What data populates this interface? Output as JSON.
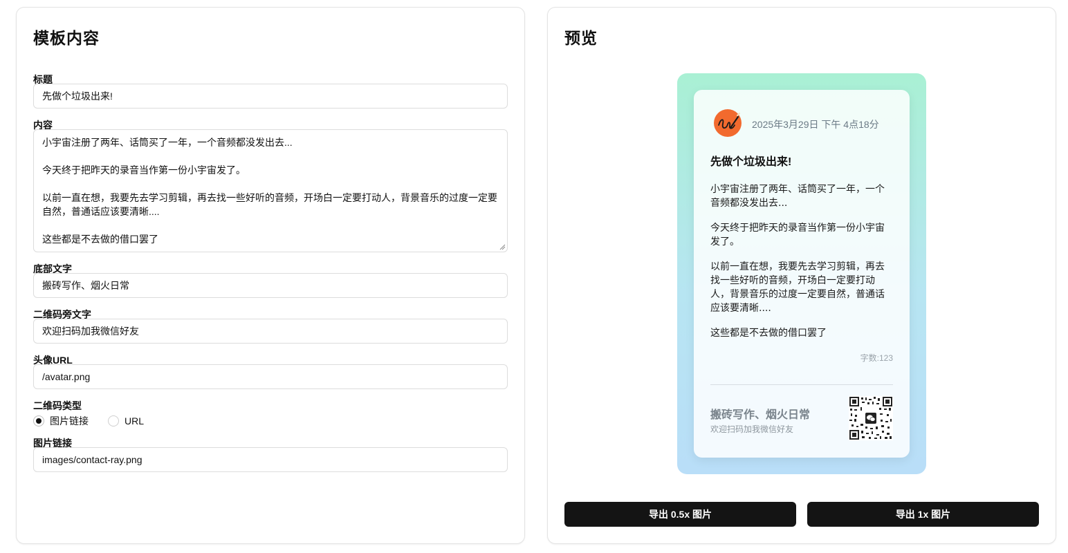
{
  "editor": {
    "title": "模板内容",
    "fields": {
      "title_label": "标题",
      "title_value": "先做个垃圾出来!",
      "content_label": "内容",
      "content_lines": [
        "小宇宙注册了两年、话筒买了一年，一个音频都没发出去...",
        "",
        "今天终于把昨天的录音当作第一份小宇宙发了。",
        "",
        "以前一直在想，我要先去学习剪辑，再去找一些好听的音频，开场白一定要打动人，背景音乐的过度一定要",
        "自然，普通话应该要清晰....",
        "",
        "这些都是不去做的借口罢了"
      ],
      "footer_label": "底部文字",
      "footer_value": "搬砖写作、烟火日常",
      "qr_text_label": "二维码旁文字",
      "qr_text_value": "欢迎扫码加我微信好友",
      "avatar_label": "头像URL",
      "avatar_value": "/avatar.png",
      "qr_type_label": "二维码类型",
      "qr_type_options": [
        "图片链接",
        "URL"
      ],
      "qr_type_selected": "图片链接",
      "image_link_label": "图片链接",
      "image_link_value": "images/contact-ray.png"
    }
  },
  "preview": {
    "title": "预览",
    "card": {
      "date": "2025年3月29日 下午 4点18分",
      "title": "先做个垃圾出来!",
      "paragraphs": [
        "小宇宙注册了两年、话筒买了一年，一个音频都没发出去...",
        "今天终于把昨天的录音当作第一份小宇宙发了。",
        "以前一直在想，我要先去学习剪辑，再去找一些好听的音频，开场白一定要打动人，背景音乐的过度一定要自然，普通话应该要清晰....",
        "这些都是不去做的借口罢了"
      ],
      "word_count": "字数:123",
      "footer_main": "搬砖写作、烟火日常",
      "footer_sub": "欢迎扫码加我微信好友",
      "avatar_icon": "signature-avatar-icon",
      "qr_icon": "wechat-qr-code-icon"
    },
    "buttons": {
      "export_half": "导出 0.5x 图片",
      "export_full": "导出 1x 图片"
    }
  },
  "colors": {
    "gradient_top": "#a9f0d4",
    "gradient_bottom": "#b9def8",
    "avatar_orange": "#f26a2e",
    "button_bg": "#141414"
  }
}
